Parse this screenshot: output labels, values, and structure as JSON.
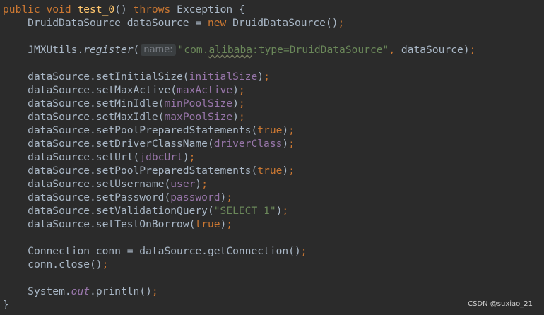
{
  "code": {
    "l1": {
      "kw1": "public",
      "kw2": "void",
      "method": "test_0",
      "paren": "()",
      "kw3": "throws",
      "rest": "Exception {"
    },
    "l2": {
      "a": "DruidDataSource dataSource = ",
      "kw": "new",
      "b": " DruidDataSource()",
      "semi": ";"
    },
    "l3": {
      "a": "JMXUtils.",
      "method": "register",
      "paren": "(",
      "hint": "name:",
      "str_a": "\"com.",
      "str_squig": "alibaba",
      "str_b": ":type=DruidDataSource\"",
      "comma": ",",
      "b": " dataSource)",
      "semi": ";"
    },
    "l4": {
      "a": "dataSource.setInitialSize(",
      "arg": "initialSize",
      "b": ")",
      "semi": ";"
    },
    "l5": {
      "a": "dataSource.setMaxActive(",
      "arg": "maxActive",
      "b": ")",
      "semi": ";"
    },
    "l6": {
      "a": "dataSource.setMinIdle(",
      "arg": "minPoolSize",
      "b": ")",
      "semi": ";"
    },
    "l7": {
      "a": "dataSource.",
      "method": "setMaxIdle",
      "paren": "(",
      "arg": "maxPoolSize",
      "b": ")",
      "semi": ";"
    },
    "l8": {
      "a": "dataSource.setPoolPreparedStatements(",
      "kw": "true",
      "b": ")",
      "semi": ";"
    },
    "l9": {
      "a": "dataSource.setDriverClassName(",
      "arg": "driverClass",
      "b": ")",
      "semi": ";"
    },
    "l10": {
      "a": "dataSource.setUrl(",
      "arg": "jdbcUrl",
      "b": ")",
      "semi": ";"
    },
    "l11": {
      "a": "dataSource.setPoolPreparedStatements(",
      "kw": "true",
      "b": ")",
      "semi": ";"
    },
    "l12": {
      "a": "dataSource.setUsername(",
      "arg": "user",
      "b": ")",
      "semi": ";"
    },
    "l13": {
      "a": "dataSource.setPassword(",
      "arg": "password",
      "b": ")",
      "semi": ";"
    },
    "l14": {
      "a": "dataSource.setValidationQuery(",
      "str": "\"SELECT 1\"",
      "b": ")",
      "semi": ";"
    },
    "l15": {
      "a": "dataSource.setTestOnBorrow(",
      "kw": "true",
      "b": ")",
      "semi": ";"
    },
    "l16": {
      "a": "Connection conn = dataSource.getConnection()",
      "semi": ";"
    },
    "l17": {
      "a": "conn.close()",
      "semi": ";"
    },
    "l18": {
      "a": "System.",
      "field": "out",
      "b": ".println()",
      "semi": ";"
    },
    "l19": {
      "a": "}"
    }
  },
  "watermark": "CSDN @suxiao_21",
  "colors": {
    "background": "#2b2b2b",
    "keyword": "#cc7832",
    "string": "#6a8759",
    "field": "#9876aa",
    "method_decl": "#ffc66d",
    "plain": "#a9b7c6"
  }
}
